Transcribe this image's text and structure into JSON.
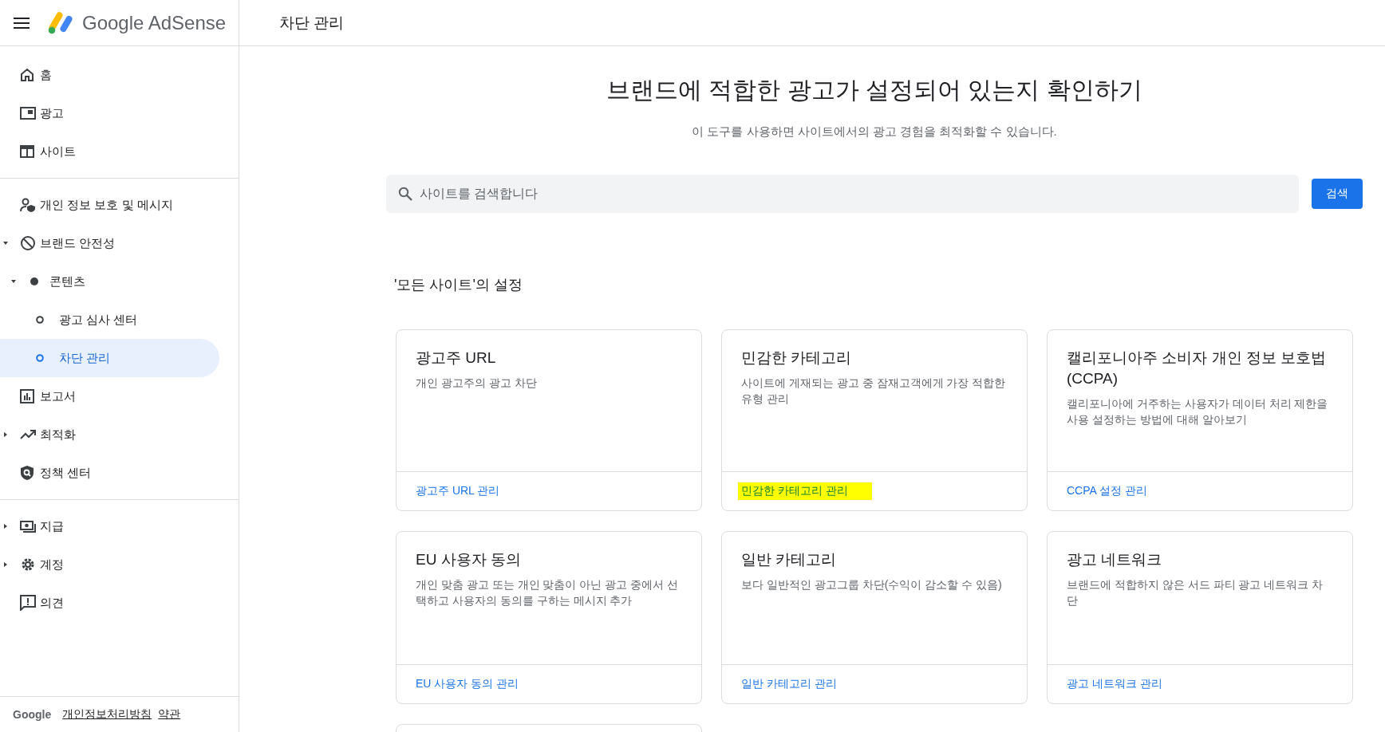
{
  "header": {
    "product": "Google AdSense",
    "page_title": "차단 관리"
  },
  "sidebar": {
    "sections": [
      {
        "items": [
          {
            "label": "홈",
            "selected": false
          },
          {
            "label": "광고",
            "selected": false
          },
          {
            "label": "사이트",
            "selected": false
          }
        ]
      },
      {
        "items": [
          {
            "label": "개인 정보 보호 및 메시지",
            "selected": false
          },
          {
            "label": "브랜드 안전성",
            "selected": false,
            "expanded": true,
            "children": [
              {
                "label": "콘텐츠",
                "selected": false,
                "expanded": true,
                "children": [
                  {
                    "label": "광고 심사 센터",
                    "selected": false
                  },
                  {
                    "label": "차단 관리",
                    "selected": true
                  }
                ]
              }
            ]
          },
          {
            "label": "보고서",
            "selected": false
          },
          {
            "label": "최적화",
            "selected": false,
            "expanded": false
          },
          {
            "label": "정책 센터",
            "selected": false
          }
        ]
      },
      {
        "items": [
          {
            "label": "지급",
            "selected": false,
            "expanded": false
          },
          {
            "label": "계정",
            "selected": false,
            "expanded": false
          },
          {
            "label": "의견",
            "selected": false
          }
        ]
      }
    ],
    "footer": {
      "brand": "Google",
      "links": [
        "개인정보처리방침",
        "약관"
      ]
    }
  },
  "hero": {
    "title": "브랜드에 적합한 광고가 설정되어 있는지 확인하기",
    "subtitle": "이 도구를 사용하면 사이트에서의 광고 경험을 최적화할 수 있습니다."
  },
  "search": {
    "placeholder": "사이트를 검색합니다",
    "button": "검색"
  },
  "section_title": "'모든 사이트'의 설정",
  "cards": [
    {
      "title": "광고주 URL",
      "description": "개인 광고주의 광고 차단",
      "link": "광고주 URL 관리",
      "highlighted": false
    },
    {
      "title": "민감한 카테고리",
      "description": "사이트에 게재되는 광고 중 잠재고객에게 가장 적합한 유형 관리",
      "link": "민감한 카테고리 관리",
      "highlighted": true
    },
    {
      "title": "캘리포니아주 소비자 개인 정보 보호법(CCPA)",
      "description": "캘리포니아에 거주하는 사용자가 데이터 처리 제한을 사용 설정하는 방법에 대해 알아보기",
      "link": "CCPA 설정 관리",
      "highlighted": false
    },
    {
      "title": "EU 사용자 동의",
      "description": "개인 맞춤 광고 또는 개인 맞춤이 아닌 광고 중에서 선택하고 사용자의 동의를 구하는 메시지 추가",
      "link": "EU 사용자 동의 관리",
      "highlighted": false
    },
    {
      "title": "일반 카테고리",
      "description": "보다 일반적인 광고그룹 차단(수익이 감소할 수 있음)",
      "link": "일반 카테고리 관리",
      "highlighted": false
    },
    {
      "title": "광고 네트워크",
      "description": "브랜드에 적합하지 않은 서드 파티 광고 네트워크 차단",
      "link": "광고 네트워크 관리",
      "highlighted": false
    }
  ],
  "more_cards_below": true
}
